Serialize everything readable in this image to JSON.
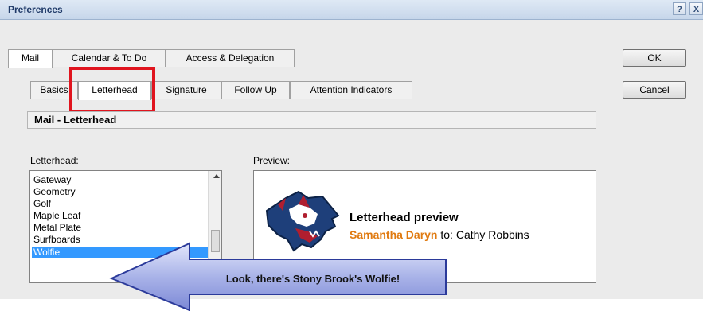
{
  "window": {
    "title": "Preferences",
    "help_label": "?",
    "close_label": "X"
  },
  "main_tabs": [
    {
      "label": "Mail",
      "active": true
    },
    {
      "label": "Calendar & To Do",
      "active": false
    },
    {
      "label": "Access & Delegation",
      "active": false
    }
  ],
  "sub_tabs": [
    {
      "label": "Basics",
      "active": false
    },
    {
      "label": "Letterhead",
      "active": true
    },
    {
      "label": "Signature",
      "active": false
    },
    {
      "label": "Follow Up",
      "active": false
    },
    {
      "label": "Attention Indicators",
      "active": false
    }
  ],
  "buttons": {
    "ok": "OK",
    "cancel": "Cancel"
  },
  "section_header": "Mail - Letterhead",
  "letterhead_label": "Letterhead:",
  "letterhead_items": [
    "Gateway",
    "Geometry",
    "Golf",
    "Maple Leaf",
    "Metal Plate",
    "Surfboards",
    "Wolfie"
  ],
  "selected_letterhead": "Wolfie",
  "preview_label": "Preview:",
  "preview": {
    "title": "Letterhead preview",
    "sender": "Samantha Daryn",
    "to_text": "to: Cathy Robbins"
  },
  "callout_text": "Look, there's Stony Brook's Wolfie!",
  "colors": {
    "highlight_box": "#e0141e",
    "selection": "#3399ff",
    "sender": "#e07a10",
    "arrow_fill": "#a9b3e8"
  },
  "icons": {
    "logo": "wolf-mascot-icon",
    "callout": "arrow-left-callout"
  }
}
